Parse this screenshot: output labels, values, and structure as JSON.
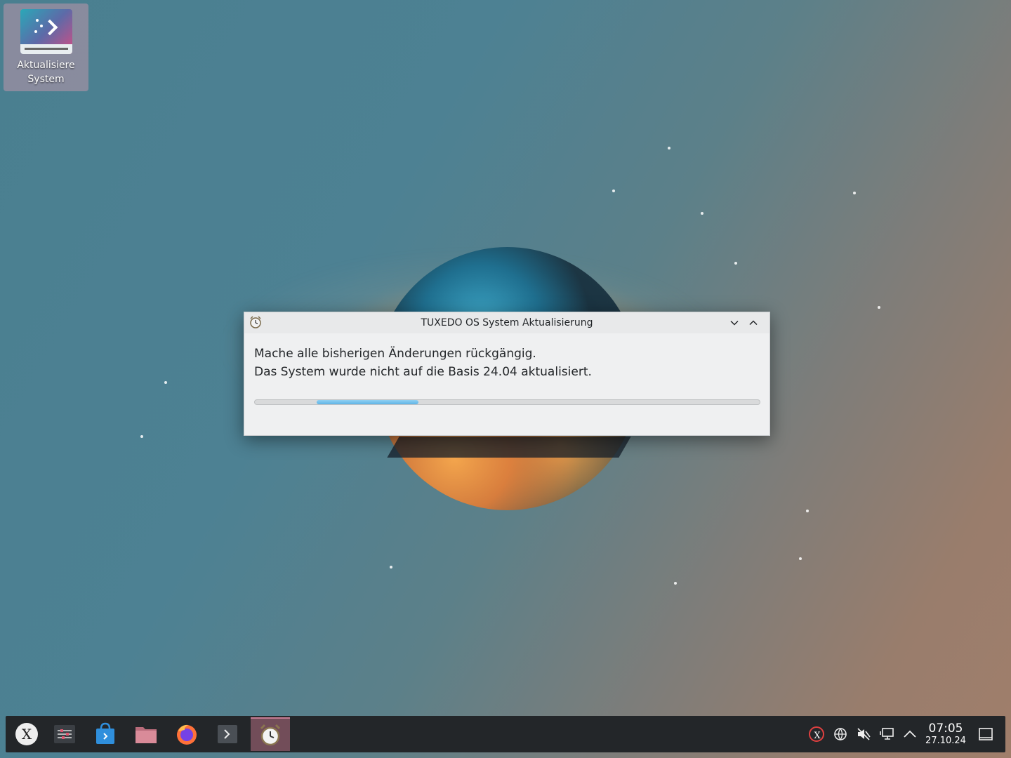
{
  "desktop": {
    "icons": [
      {
        "label": "Aktualisiere System",
        "icon": "tuxedo-update-icon"
      }
    ]
  },
  "dialog": {
    "title": "TUXEDO OS System Aktualisierung",
    "line1": "Mache alle bisherigen Änderungen rückgängig.",
    "line2": "Das System wurde nicht auf die Basis 24.04 aktualisiert.",
    "progress_state": "indeterminate"
  },
  "taskbar": {
    "launchers": [
      "tuxedo-menu-icon",
      "control-center-icon",
      "software-store-icon",
      "file-manager-icon",
      "firefox-icon",
      "terminal-icon",
      "update-alarm-icon"
    ],
    "tray": [
      "tuxedo-control-icon",
      "network-icon",
      "volume-muted-icon",
      "display-icon",
      "expand-tray-icon"
    ],
    "clock": {
      "time": "07:05",
      "date": "27.10.24"
    }
  },
  "colors": {
    "taskbar_bg": "#232629",
    "dialog_bg": "#eff0f1",
    "progress_fill": "#5fb4e6",
    "active_task": "#c77d94"
  }
}
